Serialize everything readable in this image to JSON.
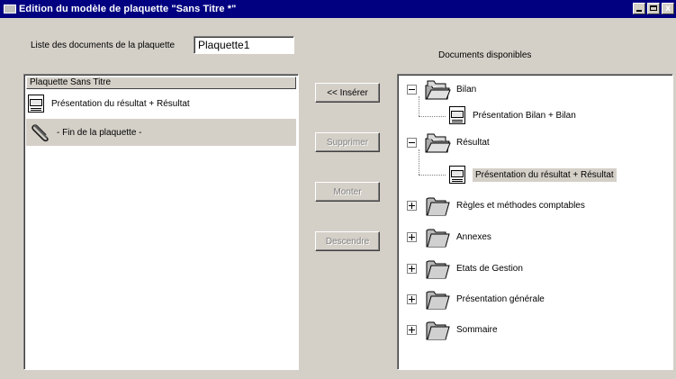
{
  "window": {
    "title": "Edition du modèle de plaquette \"Sans Titre *\"",
    "close_glyph": "x"
  },
  "left": {
    "list_label": "Liste des documents de la plaquette",
    "name_value": "Plaquette1",
    "header": "Plaquette Sans Titre",
    "items": [
      {
        "label": "Présentation du résultat + Résultat",
        "icon": "document-icon"
      },
      {
        "label": "- Fin de la plaquette -",
        "icon": "paperclip-icon"
      }
    ]
  },
  "buttons": {
    "insert": "<< Insérer",
    "delete": "Supprimer",
    "up": "Monter",
    "down": "Descendre"
  },
  "right": {
    "label": "Documents disponibles",
    "tree": [
      {
        "label": "Bilan",
        "expanded": true,
        "children": [
          "Présentation Bilan + Bilan"
        ]
      },
      {
        "label": "Résultat",
        "expanded": true,
        "children": [
          "Présentation du résultat + Résultat"
        ]
      },
      {
        "label": "Règles et méthodes comptables",
        "expanded": false
      },
      {
        "label": "Annexes",
        "expanded": false
      },
      {
        "label": "Etats de Gestion",
        "expanded": false
      },
      {
        "label": "Présentation générale",
        "expanded": false
      },
      {
        "label": "Sommaire",
        "expanded": false
      }
    ]
  }
}
